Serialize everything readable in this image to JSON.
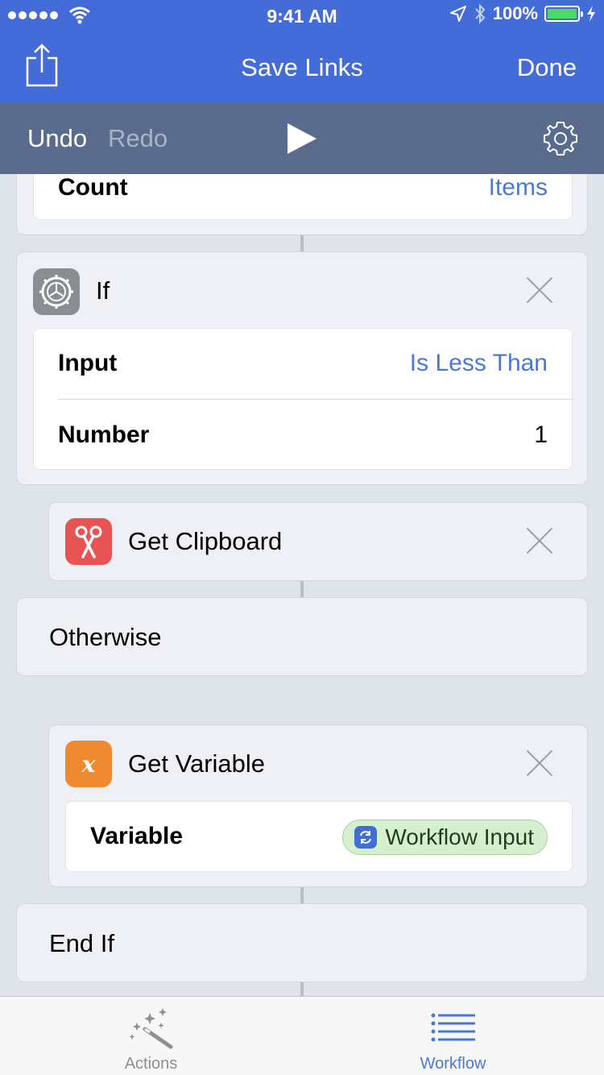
{
  "status_bar": {
    "time": "9:41 AM",
    "battery": "100%"
  },
  "nav": {
    "title": "Save Links",
    "done_label": "Done"
  },
  "toolbar": {
    "undo_label": "Undo",
    "redo_label": "Redo"
  },
  "actions": {
    "count_block": {
      "label": "Count",
      "value": "Items"
    },
    "if_block": {
      "title": "If",
      "rows": [
        {
          "label": "Input",
          "value": "Is Less Than"
        },
        {
          "label": "Number",
          "value": "1"
        }
      ]
    },
    "get_clipboard": {
      "title": "Get Clipboard"
    },
    "otherwise": {
      "title": "Otherwise"
    },
    "get_variable": {
      "title": "Get Variable",
      "variable_label": "Variable",
      "variable_value": "Workflow Input"
    },
    "end_if": {
      "title": "End If"
    }
  },
  "tabbar": {
    "tabs": [
      {
        "label": "Actions",
        "icon": "magic-wand-icon",
        "active": false
      },
      {
        "label": "Workflow",
        "icon": "list-icon",
        "active": true
      }
    ]
  },
  "colors": {
    "nav_blue": "#446cd8",
    "toolbar_slate": "#5a6c8e",
    "accent_blue": "#4a78d3",
    "clipboard_red": "#e85454",
    "variable_orange": "#f08a30",
    "pill_green": "#d5efcf"
  }
}
